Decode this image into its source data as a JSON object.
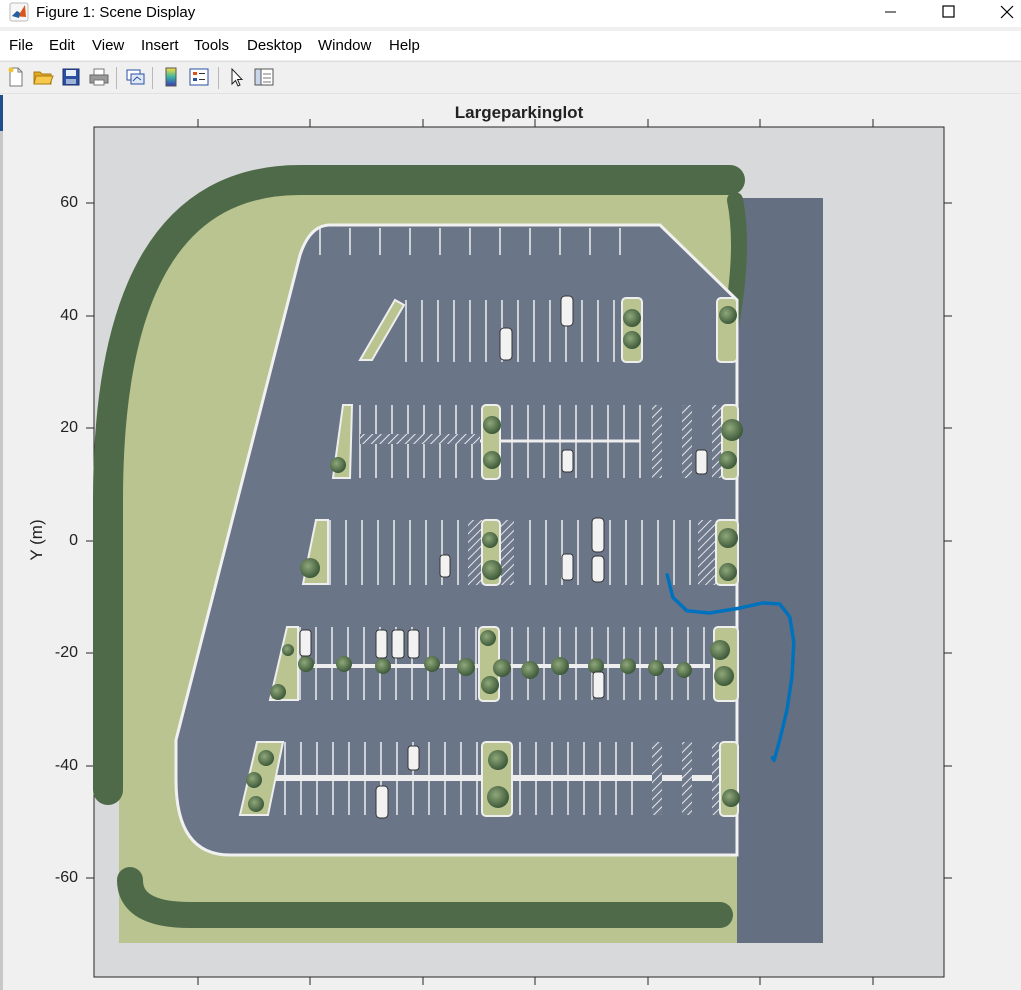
{
  "window": {
    "title": "Figure 1: Scene Display",
    "minimize_icon": "minimize-icon",
    "maximize_icon": "maximize-icon",
    "close_icon": "close-icon"
  },
  "menu": [
    "File",
    "Edit",
    "View",
    "Insert",
    "Tools",
    "Desktop",
    "Window",
    "Help"
  ],
  "toolbar": {
    "buttons": [
      "new-figure-icon",
      "open-file-icon",
      "save-icon",
      "print-icon",
      "link-plot-icon",
      "colorbar-icon",
      "legend-icon",
      "edit-plot-arrow-icon",
      "property-inspector-icon"
    ]
  },
  "axes": {
    "title": "Largeparkinglot",
    "ylabel": "Y (m)",
    "yticks": [
      "60",
      "40",
      "20",
      "0",
      "-20",
      "-40",
      "-60"
    ]
  },
  "colors": {
    "path": "#0072bd",
    "asphalt": "#646f82",
    "grass": "#b9c490",
    "trees": "#4f6a48"
  },
  "chart_data": {
    "type": "line",
    "title": "Largeparkinglot",
    "ylabel": "Y (m)",
    "xlabel": "",
    "ylim": [
      -73,
      72
    ],
    "grid": false,
    "background": "top-down image of a large parking lot",
    "series": [
      {
        "x": [
          23.5,
          24.5,
          27,
          31,
          36,
          40.5,
          43.5,
          45.3,
          46,
          45.7,
          44.8,
          43.6,
          42.5,
          42.2
        ],
        "y": [
          -6,
          -10,
          -12.4,
          -12.8,
          -12.0,
          -11.0,
          -11.2,
          -13.5,
          -18,
          -24,
          -30,
          -35,
          -39,
          -38.5
        ]
      }
    ]
  }
}
